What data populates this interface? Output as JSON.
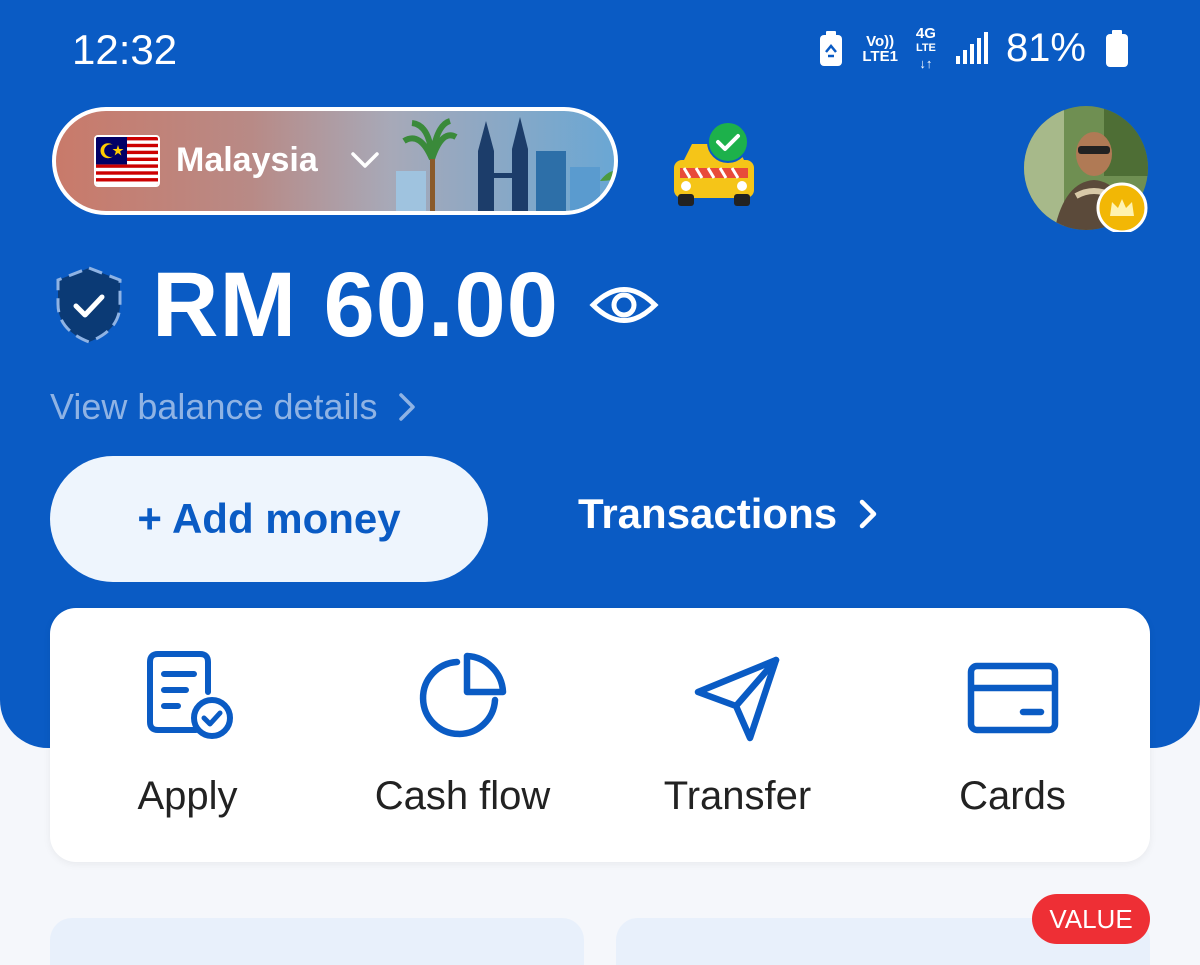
{
  "status_bar": {
    "time": "12:32",
    "volte_top": "Vo))",
    "volte_bottom": "LTE1",
    "network_top": "4G",
    "network_mid": "LTE",
    "battery_percent": "81%"
  },
  "header": {
    "country": "Malaysia"
  },
  "balance": {
    "amount": "RM 60.00",
    "view_details": "View balance details"
  },
  "buttons": {
    "add_money": "+ Add money",
    "transactions": "Transactions"
  },
  "quick_actions": [
    {
      "label": "Apply",
      "icon": "apply-document-icon"
    },
    {
      "label": "Cash flow",
      "icon": "pie-chart-icon"
    },
    {
      "label": "Transfer",
      "icon": "paper-plane-icon"
    },
    {
      "label": "Cards",
      "icon": "credit-card-icon"
    }
  ],
  "badge": {
    "value": "VALUE"
  },
  "colors": {
    "brand_blue": "#0a5bc4",
    "background": "#f5f7fb",
    "badge_red": "#ee2f35",
    "success_green": "#1db14b",
    "gold": "#f2b705"
  }
}
